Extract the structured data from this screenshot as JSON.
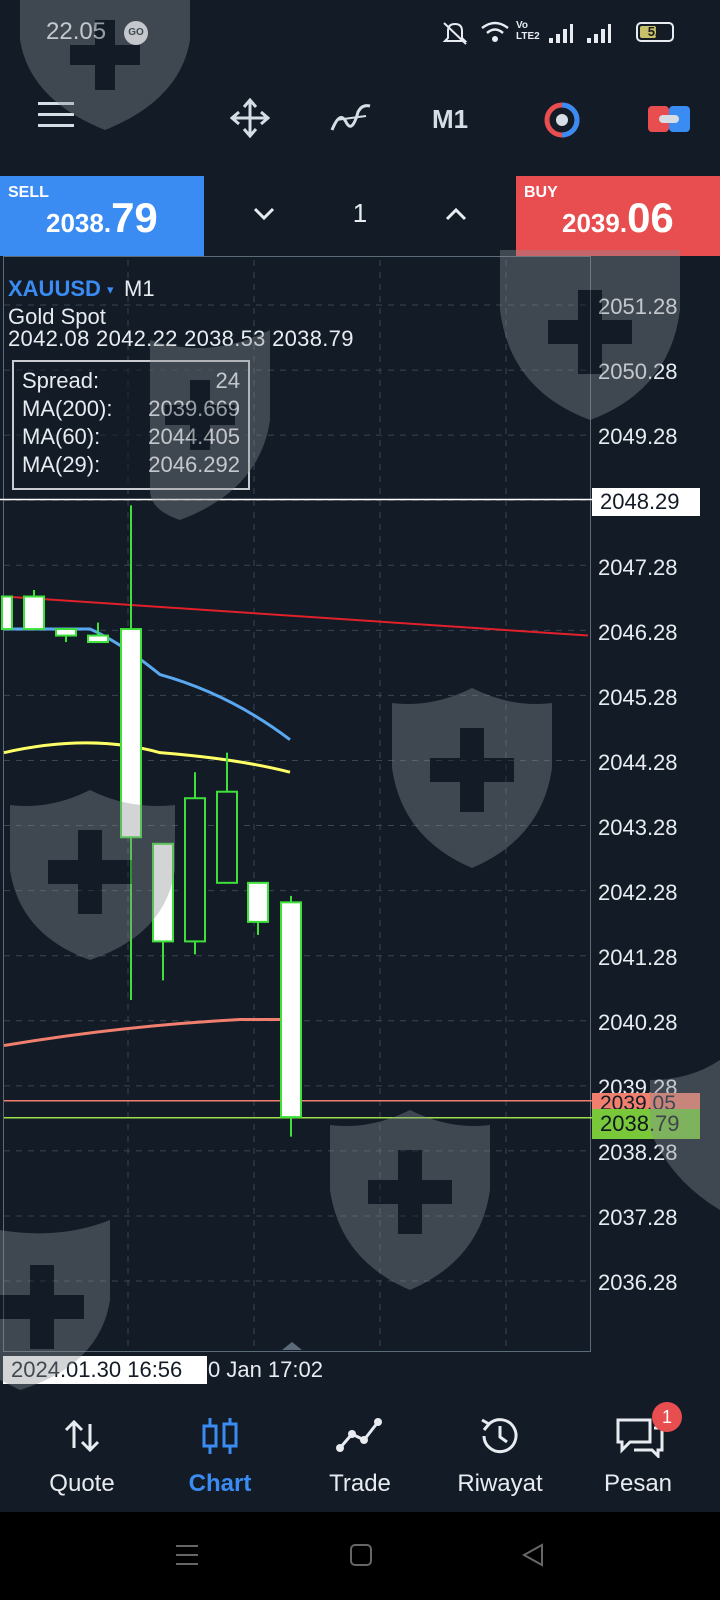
{
  "status_bar": {
    "time": "22.05",
    "go_badge": "GO",
    "battery": "52",
    "battery_level": 0.52
  },
  "toolbar": {
    "timeframe": "M1"
  },
  "trade_bar": {
    "sell_label": "SELL",
    "sell_price_small": "2038.",
    "sell_price_big": "79",
    "buy_label": "BUY",
    "buy_price_small": "2039.",
    "buy_price_big": "06",
    "lot": "1"
  },
  "chart_header": {
    "symbol": "XAUUSD",
    "symbol_arrow": "▾",
    "timeframe": "M1",
    "description": "Gold Spot",
    "ohlc": "2042.08 2042.22 2038.53 2038.79"
  },
  "info_box": {
    "rows": [
      {
        "label": "Spread:",
        "value": "24"
      },
      {
        "label": "MA(200):",
        "value": "2039.669"
      },
      {
        "label": "MA(60):",
        "value": "2044.405"
      },
      {
        "label": "MA(29):",
        "value": "2046.292"
      }
    ]
  },
  "price_axis": {
    "labels": [
      "2051.28",
      "2050.28",
      "2049.28",
      "2047.28",
      "2046.28",
      "2045.28",
      "2044.28",
      "2043.28",
      "2042.28",
      "2041.28",
      "2040.28",
      "2039.28",
      "2038.28",
      "2037.28",
      "2036.28"
    ],
    "crosshair_price": "2048.29",
    "ask_price": "2039.05",
    "bid_price": "2038.79"
  },
  "time_axis": {
    "crosshair_time": "2024.01.30 16:56",
    "next_label": "0 Jan 17:02"
  },
  "colors": {
    "accent_blue": "#3a8cf3",
    "sell_blue": "#3a8cf3",
    "buy_red": "#e84d4f",
    "candle_up_border": "#3ee03a",
    "ma200": "#f07f6e",
    "ma60": "#ffff66",
    "ma29": "#5aa8f0",
    "trend_line": "#e0202a",
    "background": "#121b26"
  },
  "chart_data": {
    "type": "candlestick",
    "symbol": "XAUUSD",
    "timeframe": "M1",
    "ylim": [
      2035.5,
      2051.8
    ],
    "candles": [
      {
        "open": 2046.8,
        "high": 2046.9,
        "low": 2046.3,
        "close": 2046.3
      },
      {
        "open": 2046.3,
        "high": 2046.3,
        "low": 2046.1,
        "close": 2046.2
      },
      {
        "open": 2046.2,
        "high": 2046.4,
        "low": 2046.1,
        "close": 2046.1
      },
      {
        "open": 2046.3,
        "high": 2048.2,
        "low": 2040.6,
        "close": 2043.1
      },
      {
        "open": 2043.0,
        "high": 2043.0,
        "low": 2040.9,
        "close": 2041.5
      },
      {
        "open": 2041.5,
        "high": 2044.1,
        "low": 2041.3,
        "close": 2043.7
      },
      {
        "open": 2042.4,
        "high": 2044.4,
        "low": 2042.4,
        "close": 2043.8
      },
      {
        "open": 2042.4,
        "high": 2042.4,
        "low": 2041.6,
        "close": 2041.8
      },
      {
        "open": 2042.1,
        "high": 2042.2,
        "low": 2038.5,
        "close": 2038.8
      }
    ],
    "moving_averages": [
      {
        "name": "MA(200)",
        "value": 2039.669
      },
      {
        "name": "MA(60)",
        "value": 2044.405
      },
      {
        "name": "MA(29)",
        "value": 2046.292
      }
    ]
  },
  "bottom_nav": {
    "items": [
      {
        "label": "Quote"
      },
      {
        "label": "Chart"
      },
      {
        "label": "Trade"
      },
      {
        "label": "Riwayat"
      },
      {
        "label": "Pesan"
      }
    ],
    "message_badge": "1"
  }
}
